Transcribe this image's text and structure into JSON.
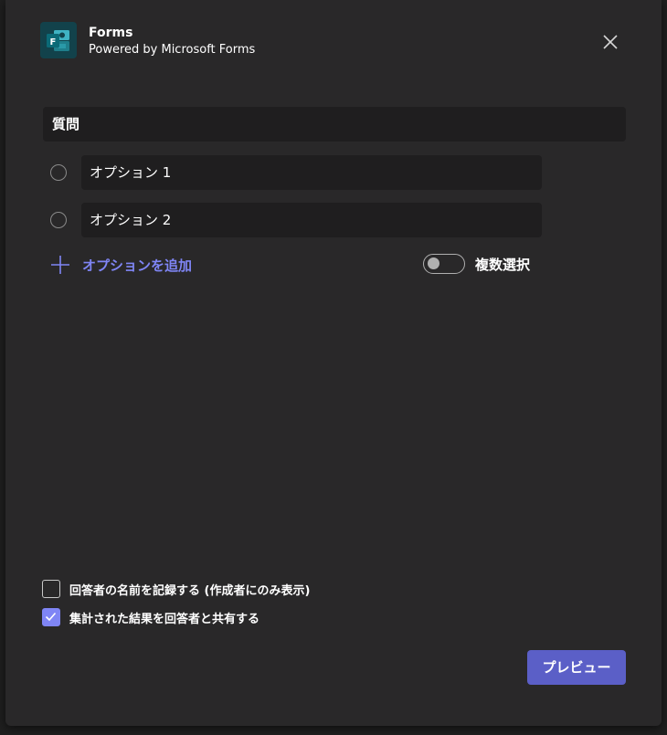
{
  "header": {
    "app_title": "Forms",
    "app_subtitle": "Powered by Microsoft Forms",
    "logo_icon": "forms-logo-icon",
    "close_icon": "close-icon"
  },
  "question": {
    "value": "質問"
  },
  "options": [
    {
      "value": "オプション 1"
    },
    {
      "value": "オプション 2"
    }
  ],
  "add_option": {
    "label": "オプションを追加",
    "icon": "plus-icon"
  },
  "multi_select": {
    "label": "複数選択",
    "enabled": false
  },
  "settings": {
    "record_names": {
      "label": "回答者の名前を記録する (作成者にのみ表示)",
      "checked": false
    },
    "share_results": {
      "label": "集計された結果を回答者と共有する",
      "checked": true
    }
  },
  "footer": {
    "preview_label": "プレビュー"
  },
  "colors": {
    "accent": "#7f85f5",
    "button": "#5b5fc7",
    "dialog_bg": "#292829",
    "field_bg": "#1f1e1f"
  }
}
